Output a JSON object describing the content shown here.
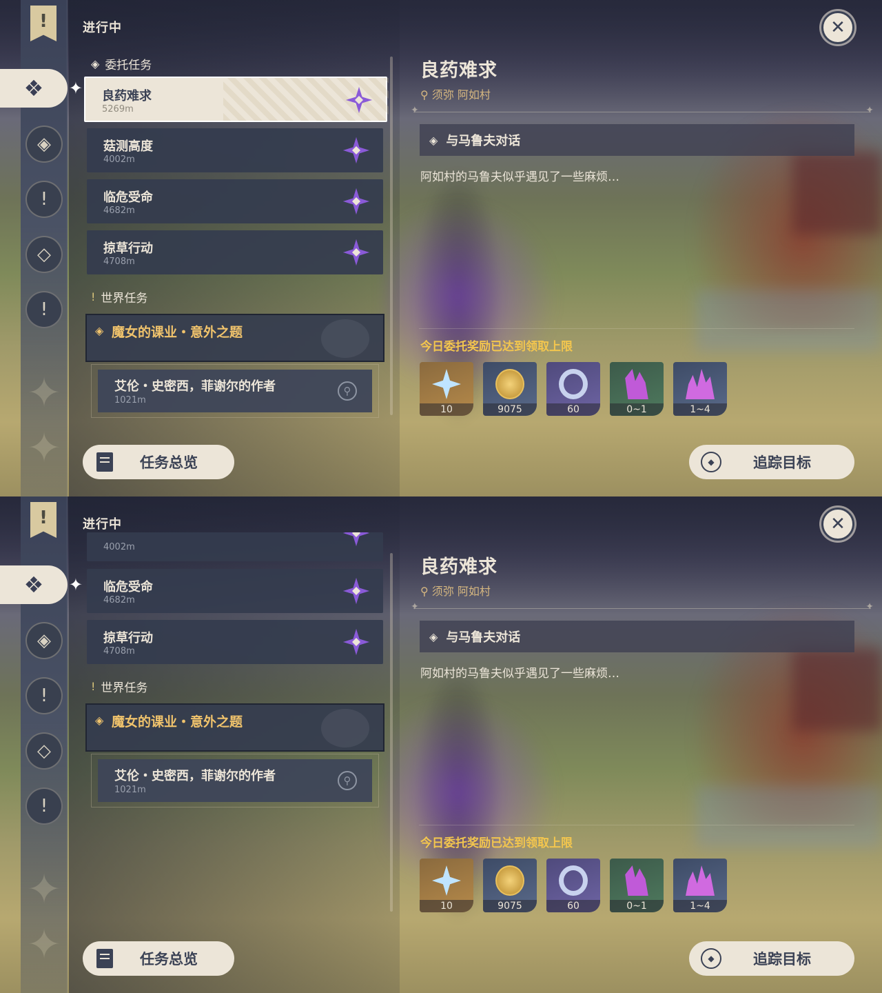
{
  "header": "进行中",
  "close_icon": "close-icon",
  "sections": {
    "commission": "委托任务",
    "world": "世界任务"
  },
  "commissions": [
    {
      "name": "良药难求",
      "distance": "5269m"
    },
    {
      "name": "菇测高度",
      "distance": "4002m"
    },
    {
      "name": "临危受命",
      "distance": "4682m"
    },
    {
      "name": "掠草行动",
      "distance": "4708m"
    }
  ],
  "world_quest": {
    "title": "魔女的课业・意外之题",
    "sub_title": "艾伦・史密西，菲谢尔的作者",
    "sub_distance": "1021m"
  },
  "detail": {
    "title": "良药难求",
    "location": "须弥 阿如村",
    "step": "与马鲁夫对话",
    "description": "阿如村的马鲁夫似乎遇见了一些麻烦…",
    "reward_note": "今日委托奖励已达到领取上限",
    "rewards": [
      {
        "name": "primogem-icon",
        "count": "10"
      },
      {
        "name": "mora-icon",
        "count": "9075"
      },
      {
        "name": "adventure-exp-icon",
        "count": "60"
      },
      {
        "name": "crystal-icon",
        "count": "0~1"
      },
      {
        "name": "crystal-cluster-icon",
        "count": "1~4"
      }
    ]
  },
  "buttons": {
    "overview": "任务总览",
    "track": "追踪目标"
  },
  "colors": {
    "accent_gold": "#f3c64e",
    "cream": "#ece5d8",
    "navy": "#3b4255"
  }
}
